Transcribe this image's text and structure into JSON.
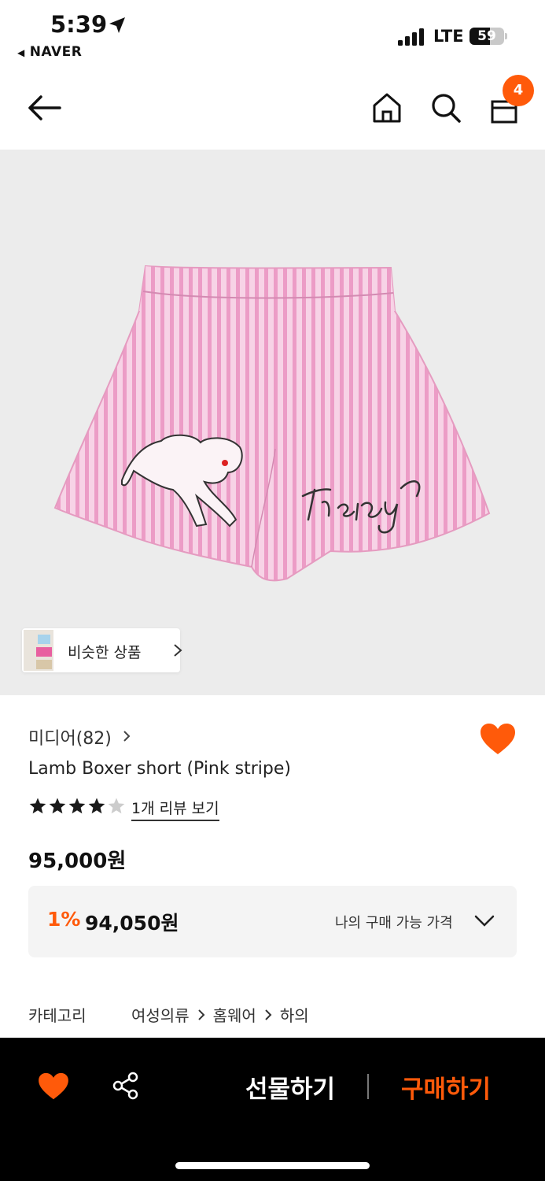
{
  "status_bar": {
    "time": "5:39",
    "back_app": "NAVER",
    "network": "LTE",
    "battery": "59",
    "battery_level": 0.59
  },
  "nav": {
    "cart_count": "4",
    "icons": [
      "back-arrow-icon",
      "home-icon",
      "search-icon",
      "shopping-bag-icon"
    ]
  },
  "hero": {
    "similar_label": "비슷한 상품"
  },
  "product": {
    "brand": "미디어(82)",
    "title": "Lamb Boxer short (Pink stripe)",
    "rating": 4,
    "rating_max": 5,
    "review_link": "1개 리뷰 보기",
    "price": "95,000원",
    "wishlisted": true
  },
  "price_box": {
    "discount_pct": "1%",
    "discount_price": "94,050원",
    "my_price_label": "나의 구매 가능 가격"
  },
  "category": {
    "label": "카테고리",
    "path": [
      "여성의류",
      "홈웨어",
      "하의"
    ]
  },
  "bottom_bar": {
    "gift_label": "선물하기",
    "buy_label": "구매하기"
  },
  "colors": {
    "accent": "#ff5a0a",
    "hero_bg": "#ececec",
    "bottom_bar_bg": "#000000",
    "short_pink": "#f3b8d6"
  }
}
